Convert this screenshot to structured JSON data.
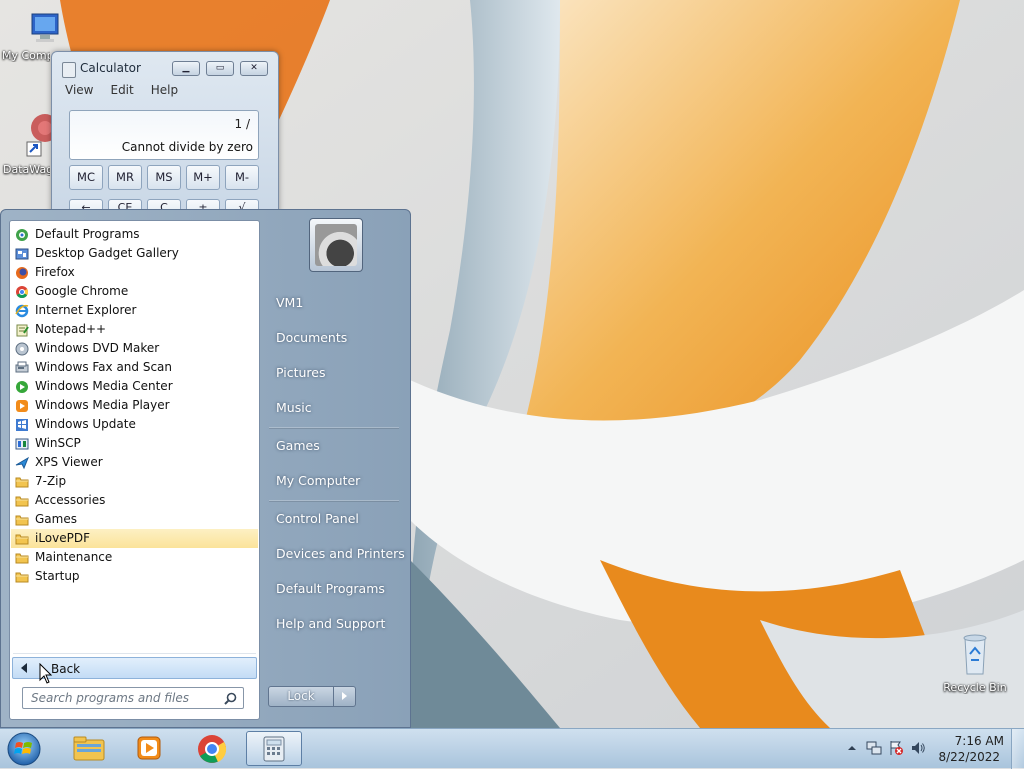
{
  "desktop": {
    "icons": [
      {
        "label": "My Computer"
      },
      {
        "label": "DataWagon"
      },
      {
        "label": "Recycle Bin"
      }
    ]
  },
  "calculator": {
    "title": "Calculator",
    "menu": [
      "View",
      "Edit",
      "Help"
    ],
    "display_expression": "1 /",
    "display_result": "Cannot divide by zero",
    "memory_buttons": [
      "MC",
      "MR",
      "MS",
      "M+",
      "M-"
    ],
    "partial_row": [
      "←",
      "CE",
      "C",
      "±",
      "√"
    ]
  },
  "start_menu": {
    "programs": [
      {
        "label": "Default Programs",
        "icon": "default-programs-icon"
      },
      {
        "label": "Desktop Gadget Gallery",
        "icon": "gadget-icon"
      },
      {
        "label": "Firefox",
        "icon": "firefox-icon"
      },
      {
        "label": "Google Chrome",
        "icon": "chrome-icon"
      },
      {
        "label": "Internet Explorer",
        "icon": "ie-icon"
      },
      {
        "label": "Notepad++",
        "icon": "notepadpp-icon"
      },
      {
        "label": "Windows DVD Maker",
        "icon": "dvd-icon"
      },
      {
        "label": "Windows Fax and Scan",
        "icon": "fax-icon"
      },
      {
        "label": "Windows Media Center",
        "icon": "media-center-icon"
      },
      {
        "label": "Windows Media Player",
        "icon": "media-player-icon"
      },
      {
        "label": "Windows Update",
        "icon": "update-icon"
      },
      {
        "label": "WinSCP",
        "icon": "winscp-icon"
      },
      {
        "label": "XPS Viewer",
        "icon": "xps-icon"
      },
      {
        "label": "7-Zip",
        "icon": "folder-icon"
      },
      {
        "label": "Accessories",
        "icon": "folder-icon"
      },
      {
        "label": "Games",
        "icon": "folder-icon"
      },
      {
        "label": "iLovePDF",
        "icon": "folder-icon",
        "selected": true
      },
      {
        "label": "Maintenance",
        "icon": "folder-icon"
      },
      {
        "label": "Startup",
        "icon": "folder-icon"
      }
    ],
    "back_label": "Back",
    "search_placeholder": "Search programs and files",
    "right_links": [
      "VM1",
      "Documents",
      "Pictures",
      "Music",
      "Games",
      "My Computer",
      "Control Panel",
      "Devices and Printers",
      "Default Programs",
      "Help and Support"
    ],
    "lock_label": "Lock"
  },
  "taskbar": {
    "time": "7:16 AM",
    "date": "8/22/2022",
    "pinned": [
      "windows-explorer-icon",
      "media-player-icon",
      "chrome-icon",
      "calculator-icon"
    ]
  },
  "colors": {
    "selection": "#fbe39a",
    "start_menu": "#8aa1b8",
    "taskbar": "#a9c4dc"
  }
}
